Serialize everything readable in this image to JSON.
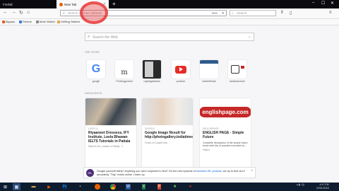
{
  "tabs": [
    {
      "label": "Firefall"
    },
    {
      "label": "New Tab"
    }
  ],
  "new_tab_symbol": "+",
  "urlbar": {
    "placeholder": "Search or enter address",
    "zoom": "90%"
  },
  "searchbar": {
    "placeholder": "Search"
  },
  "bookmarks": [
    {
      "label": "Bypass",
      "color": "#e25b26"
    },
    {
      "label": "Flexine",
      "color": "#3a7bd5"
    },
    {
      "label": "Most Visited",
      "color": "#888888"
    },
    {
      "label": "Getting Started",
      "color": "#e8a33d"
    }
  ],
  "page_search": {
    "placeholder": "Search the Web"
  },
  "top_sites_label": "TOP SITES",
  "top_sites": [
    {
      "name": "google"
    },
    {
      "name": "Freeimgpoland"
    },
    {
      "name": "Lightagateland"
    },
    {
      "name": "youtube"
    },
    {
      "name": "bobberflinak"
    },
    {
      "name": "laloshakodore"
    }
  ],
  "highlights_label": "HIGHLIGHTS",
  "highlights": [
    {
      "source": "Livecol",
      "title": "Riyaaneet Dressess, IFY Institute, Leela Bhawan IELTS Tutorials in Patiala",
      "meta": "Rated 5.0/5, Location in Patiala · 3"
    },
    {
      "source": "Google",
      "title": "Google Image Result for http://photogallery.indiatimes.com/photo",
      "meta": "Found on Google Now"
    },
    {
      "source": "Englishpage",
      "title": "ENGLISH PAGE - Simple Future",
      "desc": "Complete description of the simple future tense with lots of practice exercises to...",
      "meta": "Visited"
    }
  ],
  "englishpage_logo": "englishpage.com",
  "snippet": {
    "text": "Google yourself lately? Anything you were surprised to find? On the new episode of ",
    "link": "Mozilla's IRL podcast",
    "tail": ", we try to find out if accurately \"Tidy\" exists online. Listen up."
  },
  "tray": {
    "time": "4:47 PM",
    "date": "22/01/2018"
  }
}
